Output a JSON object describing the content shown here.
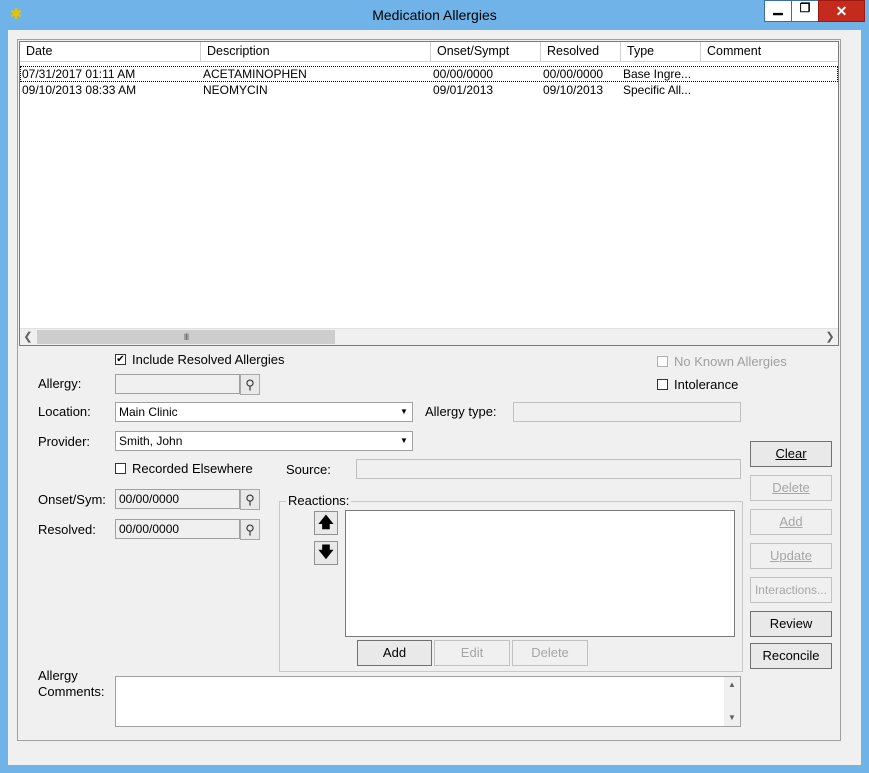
{
  "window": {
    "title": "Medication Allergies",
    "icon": "gear-icon"
  },
  "titlebar_buttons": {
    "minimize": "▁",
    "maximize": "❐",
    "close": "✕"
  },
  "table": {
    "columns": [
      "Date",
      "Description",
      "Onset/Sympt",
      "Resolved",
      "Type",
      "Comment"
    ],
    "rows": [
      [
        "07/31/2017 01:11 AM",
        "ACETAMINOPHEN",
        "00/00/0000",
        "00/00/0000",
        "Base Ingre...",
        ""
      ],
      [
        "09/10/2013 08:33 AM",
        "NEOMYCIN",
        "09/01/2013",
        "09/10/2013",
        "Specific All...",
        ""
      ]
    ],
    "scroll_grip": "III"
  },
  "form": {
    "include_resolved_label": "Include Resolved Allergies",
    "include_resolved_checked": "✔",
    "no_known_label": "No Known Allergies",
    "intolerance_label": "Intolerance",
    "allergy_label": "Allergy:",
    "allergy_value": "",
    "location_label": "Location:",
    "location_value": "Main Clinic",
    "allergy_type_label": "Allergy type:",
    "allergy_type_value": "",
    "provider_label": "Provider:",
    "provider_value": "Smith, John",
    "recorded_elsewhere_label": "Recorded Elsewhere",
    "source_label": "Source:",
    "source_value": "",
    "onset_label": "Onset/Sym:",
    "onset_value": "00/00/0000",
    "resolved_label": "Resolved:",
    "resolved_value": "00/00/0000",
    "reactions_label": "Reactions:",
    "comments_label_1": "Allergy",
    "comments_label_2": "Comments:"
  },
  "reaction_buttons": {
    "add": "Add",
    "edit": "Edit",
    "delete": "Delete"
  },
  "side_buttons": {
    "clear": "Clear",
    "delete": "Delete",
    "add": "Add",
    "update": "Update",
    "interactions": "Interactions...",
    "review": "Review",
    "reconcile": "Reconcile"
  }
}
